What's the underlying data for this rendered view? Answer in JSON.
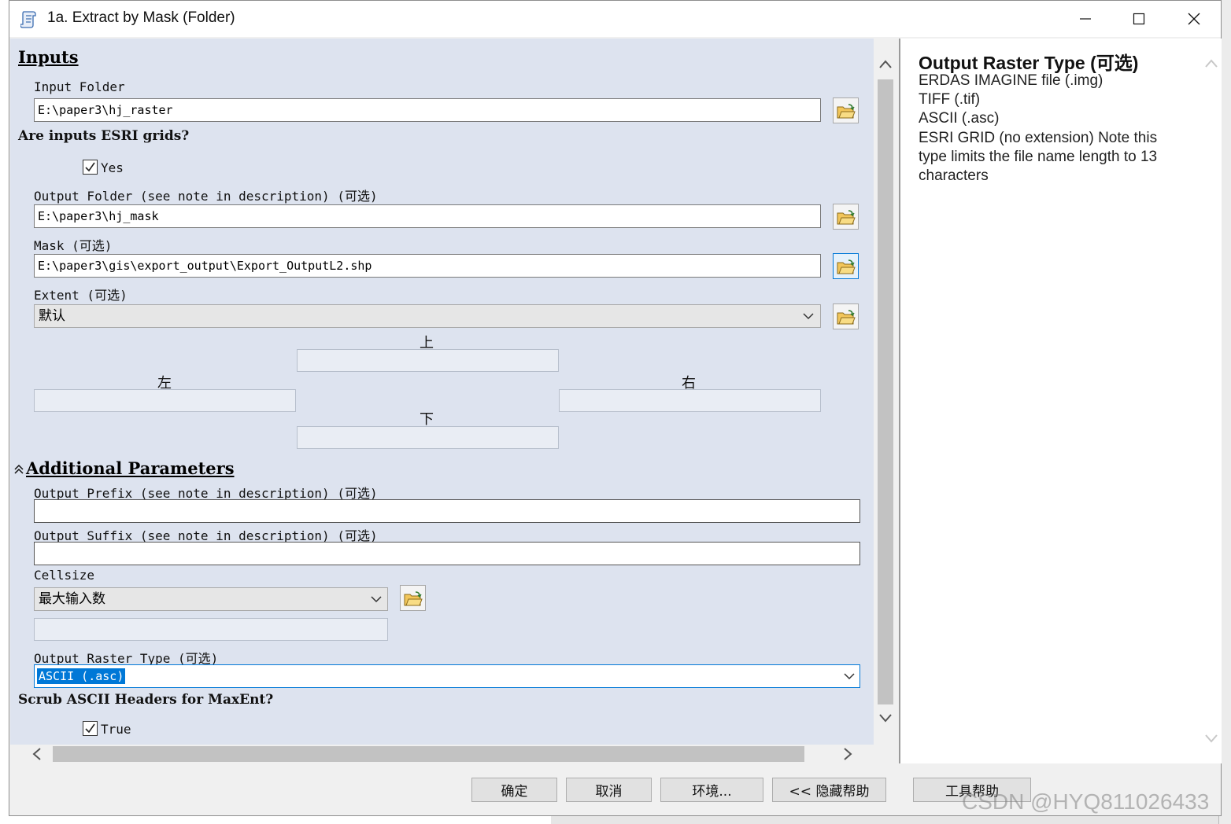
{
  "window": {
    "title": "1a. Extract by Mask (Folder)",
    "icon": "script-tool-icon",
    "controls": [
      "minimize-icon",
      "maximize-icon",
      "close-icon"
    ]
  },
  "inputs": {
    "section_title": "Inputs",
    "input_folder": {
      "label": "Input Folder",
      "value": "E:\\paper3\\hj_raster"
    },
    "esri_grids": {
      "question": "Are inputs ESRI grids?",
      "checkbox_label": "Yes",
      "checked": true
    },
    "output_folder": {
      "label": "Output Folder (see note in description) (可选)",
      "value": "E:\\paper3\\hj_mask"
    },
    "mask": {
      "label": "Mask (可选)",
      "value": "E:\\paper3\\gis\\export_output\\Export_OutputL2.shp"
    },
    "extent": {
      "label": "Extent (可选)",
      "selected": "默认",
      "top_label": "上",
      "left_label": "左",
      "right_label": "右",
      "bottom_label": "下",
      "top": "",
      "left": "",
      "right": "",
      "bottom": ""
    }
  },
  "additional": {
    "section_title": "Additional Parameters",
    "expander_icon": "chevron-double-up-icon",
    "output_prefix": {
      "label": "Output Prefix (see note in description) (可选)",
      "value": ""
    },
    "output_suffix": {
      "label": "Output Suffix (see note in description) (可选)",
      "value": ""
    },
    "cellsize": {
      "label": "Cellsize",
      "selected": "最大输入数",
      "value": ""
    },
    "output_raster_type": {
      "label": "Output Raster Type (可选)",
      "selected": "ASCII (.asc)"
    },
    "scrub": {
      "question": "Scrub ASCII Headers for MaxEnt?",
      "checkbox_label": "True",
      "checked": true
    }
  },
  "help": {
    "title": "Output Raster Type (可选)",
    "lines": [
      "ERDAS IMAGINE file (.img)",
      "TIFF (.tif)",
      "ASCII (.asc)",
      "ESRI GRID (no extension) Note this type limits the file name length to 13 characters"
    ]
  },
  "buttons": {
    "ok": "确定",
    "cancel": "取消",
    "environments": "环境...",
    "hide_help": "<< 隐藏帮助",
    "tool_help": "工具帮助"
  },
  "watermark": "CSDN @HYQ811026433",
  "colors": {
    "pane_bg": "#dde3ef",
    "selection": "#0078d7",
    "focus_border": "#0078d7"
  }
}
